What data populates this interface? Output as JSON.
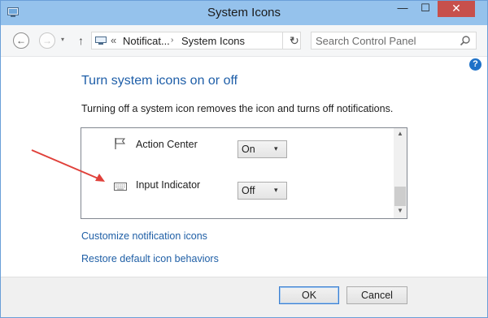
{
  "window": {
    "title": "System Icons",
    "controls": {
      "minimize": "—",
      "maximize": "☐",
      "close": "✕"
    }
  },
  "navbar": {
    "back_glyph": "←",
    "forward_glyph": "→",
    "recent_glyph": "▾",
    "up_glyph": "↑",
    "breadcrumb": {
      "separator": "«",
      "items": [
        "Notificat...",
        "System Icons"
      ],
      "arrow": "›"
    },
    "address_dropdown_glyph": "▾",
    "refresh_glyph": "↻",
    "search": {
      "placeholder": "Search Control Panel"
    }
  },
  "help": {
    "glyph": "?"
  },
  "content": {
    "title": "Turn system icons on or off",
    "description": "Turning off a system icon removes the icon and turns off notifications.",
    "icons": [
      {
        "label": "Action Center",
        "icon": "flag-icon",
        "value": "On"
      },
      {
        "label": "Input Indicator",
        "icon": "keyboard-icon",
        "value": "Off"
      }
    ],
    "select_arrow": "▾",
    "scroll_up": "▲",
    "scroll_down": "▼",
    "links": {
      "customize": "Customize notification icons",
      "restore": "Restore default icon behaviors"
    }
  },
  "annotation": {
    "arrow_color": "#e0403a"
  },
  "footer": {
    "ok": "OK",
    "cancel": "Cancel"
  },
  "colors": {
    "title_bar": "#95c2ec",
    "heading": "#1e5ea8",
    "link": "#1f5fa6",
    "close_button": "#c7504c"
  }
}
